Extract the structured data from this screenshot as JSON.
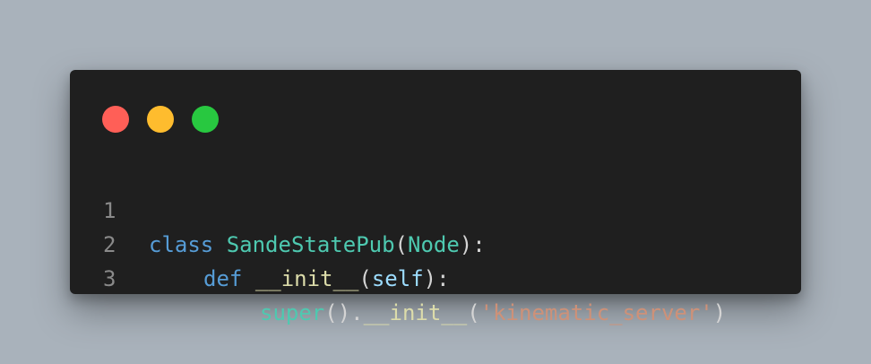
{
  "window": {
    "traffic_lights": [
      {
        "name": "close",
        "color": "#ff5f57"
      },
      {
        "name": "minimize",
        "color": "#febc2e"
      },
      {
        "name": "maximize",
        "color": "#28c840"
      }
    ]
  },
  "code": {
    "language": "python",
    "lines": [
      {
        "number": "1",
        "tokens": [
          {
            "text": "class",
            "role": "keyword"
          },
          {
            "text": " ",
            "role": "plain"
          },
          {
            "text": "SandeStatePub",
            "role": "class"
          },
          {
            "text": "(",
            "role": "plain"
          },
          {
            "text": "Node",
            "role": "class"
          },
          {
            "text": "):",
            "role": "plain"
          }
        ]
      },
      {
        "number": "2",
        "tokens": [
          {
            "text": "def",
            "role": "keyword"
          },
          {
            "text": " ",
            "role": "plain"
          },
          {
            "text": "__init__",
            "role": "function"
          },
          {
            "text": "(",
            "role": "plain"
          },
          {
            "text": "self",
            "role": "parameter"
          },
          {
            "text": "):",
            "role": "plain"
          }
        ]
      },
      {
        "number": "3",
        "tokens": [
          {
            "text": "super",
            "role": "class"
          },
          {
            "text": "().",
            "role": "plain"
          },
          {
            "text": "__init__",
            "role": "function"
          },
          {
            "text": "(",
            "role": "plain"
          },
          {
            "text": "'kinematic_server'",
            "role": "string"
          },
          {
            "text": ")",
            "role": "plain"
          }
        ]
      }
    ]
  }
}
